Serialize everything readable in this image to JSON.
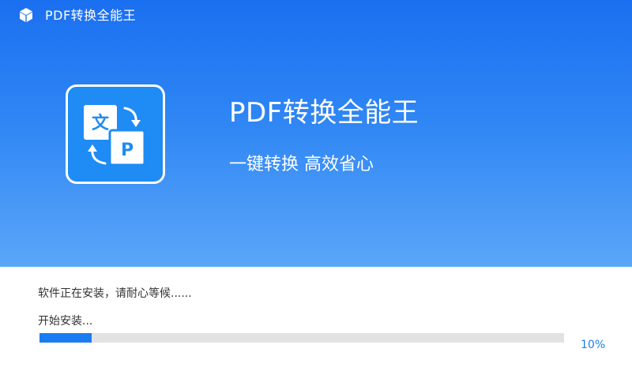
{
  "window": {
    "title": "PDF转换全能王",
    "icon": "cube-icon"
  },
  "hero": {
    "logo_icon": "translate-doc-icon",
    "logo_glyphs": [
      "文",
      "P"
    ],
    "title": "PDF转换全能王",
    "slogan": "一键转换 高效省心"
  },
  "install": {
    "status": "软件正在安装，请耐心等候......",
    "step": "开始安装...",
    "progress": 0.1,
    "progress_label": "10%"
  },
  "colors": {
    "accent": "#1a7cf0",
    "hero_top": "#1a6ff0",
    "hero_bottom": "#5aa6f8",
    "track": "#e2e2e2"
  }
}
